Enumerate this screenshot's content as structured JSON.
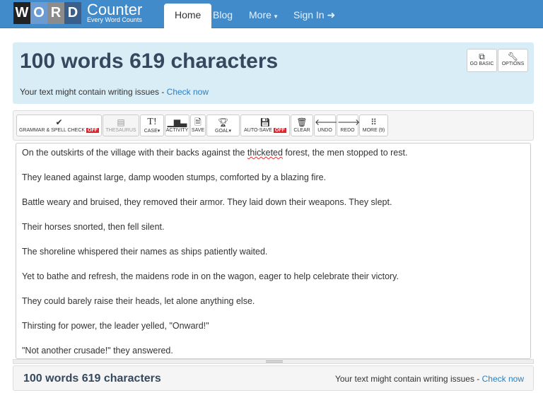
{
  "nav": {
    "logo_letters": [
      "W",
      "O",
      "R",
      "D"
    ],
    "logo_colors": [
      "#222222",
      "#6b9bd1",
      "#8c8c8c",
      "#3a5f8a"
    ],
    "logo_title": "Counter",
    "logo_tagline": "Every Word Counts",
    "items": [
      "Home",
      "Blog",
      "More",
      "Sign In"
    ],
    "active": "Home"
  },
  "header": {
    "title": "100 words 619 characters",
    "issues_text": "Your text might contain writing issues - ",
    "issues_link": "Check now",
    "go_basic": "GO BASIC",
    "options": "OPTIONS"
  },
  "toolbar": {
    "grammar": "GRAMMAR & SPELL CHECK",
    "grammar_state": "OFF",
    "thesaurus": "THESAURUS",
    "case": "CASE",
    "activity": "ACTIVITY",
    "save": "SAVE",
    "goal": "GOAL",
    "autosave": "AUTO-SAVE",
    "autosave_state": "OFF",
    "clear": "CLEAR",
    "undo": "UNDO",
    "redo": "REDO",
    "more": "MORE (9)"
  },
  "editor": {
    "line0_a": "On the outskirts of the village with their backs against the ",
    "line0_err": "thicketed",
    "line0_b": " forest, the men stopped to rest.",
    "lines": [
      "They leaned against large, damp wooden stumps, comforted by a blazing fire.",
      "Battle weary and bruised, they removed their armor. They laid down their weapons. They slept.",
      "Their horses snorted, then fell silent.",
      "The shoreline whispered their names as ships patiently waited.",
      "Yet to bathe and refresh, the maidens rode in on the wagon, eager to help celebrate their victory.",
      "They could barely raise their heads, let alone anything else.",
      "Thirsting for power, the leader yelled,  \"Onward!\"",
      "\"Not another crusade!\" they answered."
    ]
  },
  "footer": {
    "title": "100 words 619 characters",
    "issues_text": "Your text might contain writing issues - ",
    "issues_link": "Check now"
  }
}
